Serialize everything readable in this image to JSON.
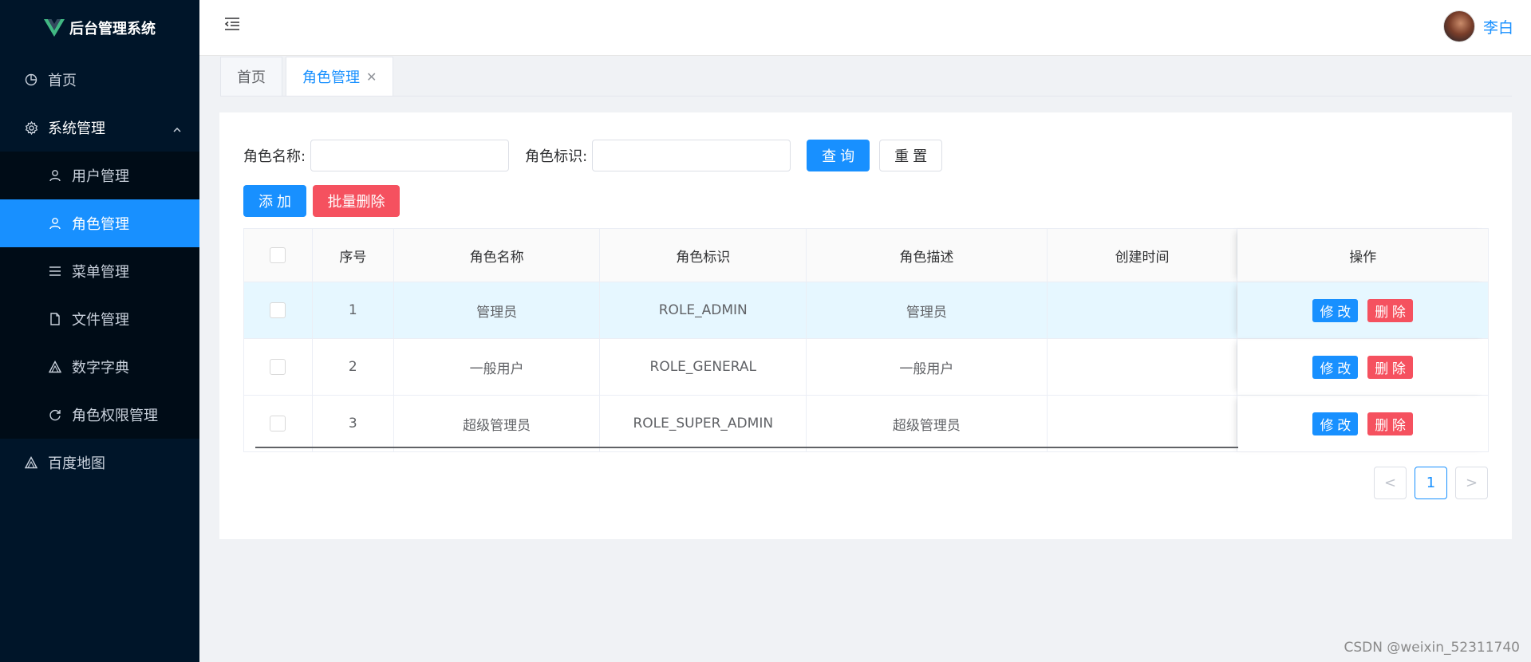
{
  "app": {
    "title": "后台管理系统"
  },
  "sidebar": {
    "items": [
      {
        "label": "首页",
        "icon": "pie-chart-icon"
      },
      {
        "label": "系统管理",
        "icon": "gear-icon",
        "expanded": true
      },
      {
        "label": "用户管理",
        "icon": "user-icon"
      },
      {
        "label": "角色管理",
        "icon": "user-icon",
        "active": true
      },
      {
        "label": "菜单管理",
        "icon": "list-icon"
      },
      {
        "label": "文件管理",
        "icon": "document-icon"
      },
      {
        "label": "数字字典",
        "icon": "triangle-icon"
      },
      {
        "label": "角色权限管理",
        "icon": "refresh-icon"
      },
      {
        "label": "百度地图",
        "icon": "triangle-icon"
      }
    ]
  },
  "header": {
    "username": "李白"
  },
  "tabs": [
    {
      "label": "首页"
    },
    {
      "label": "角色管理",
      "active": true
    }
  ],
  "search": {
    "role_name_label": "角色名称:",
    "role_key_label": "角色标识:",
    "role_name_value": "",
    "role_key_value": "",
    "query_label": "查 询",
    "reset_label": "重 置"
  },
  "actions": {
    "add_label": "添 加",
    "batch_delete_label": "批量删除"
  },
  "table": {
    "columns": [
      "序号",
      "角色名称",
      "角色标识",
      "角色描述",
      "创建时间",
      "操作"
    ],
    "rows": [
      {
        "index": "1",
        "name": "管理员",
        "key": "ROLE_ADMIN",
        "desc": "管理员",
        "created": ""
      },
      {
        "index": "2",
        "name": "一般用户",
        "key": "ROLE_GENERAL",
        "desc": "一般用户",
        "created": ""
      },
      {
        "index": "3",
        "name": "超级管理员",
        "key": "ROLE_SUPER_ADMIN",
        "desc": "超级管理员",
        "created": ""
      }
    ],
    "edit_label": "修 改",
    "delete_label": "删 除"
  },
  "pagination": {
    "prev": "<",
    "current": "1",
    "next": ">"
  },
  "watermark": "CSDN @weixin_52311740",
  "colors": {
    "sidebar_bg": "#001529",
    "primary": "#1890ff",
    "danger": "#f5515f"
  }
}
